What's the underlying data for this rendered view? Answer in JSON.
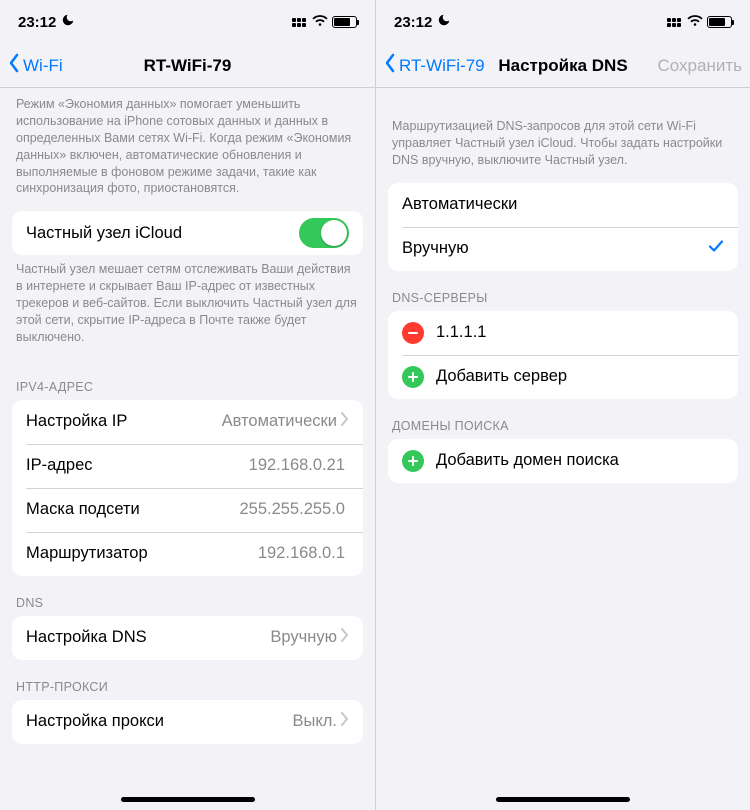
{
  "status": {
    "time": "23:12"
  },
  "left": {
    "nav": {
      "back": "Wi-Fi",
      "title": "RT-WiFi-79"
    },
    "dataSaverFooter": "Режим «Экономия данных» помогает уменьшить использование на iPhone сотовых данных и данных в определенных Вами сетях Wi-Fi. Когда режим «Экономия данных» включен, автоматические обновления и выполняемые в фоновом режиме задачи, такие как синхронизация фото, приостановятся.",
    "privateRelay": {
      "label": "Частный узел iCloud"
    },
    "privateRelayFooter": "Частный узел мешает сетям отслеживать Ваши действия в интернете и скрывает Ваш IP-адрес от известных трекеров и веб-сайтов. Если выключить Частный узел для этой сети, скрытие IP-адреса в Почте также будет выключено.",
    "ipv4": {
      "header": "IPV4-АДРЕС",
      "configure": {
        "label": "Настройка IP",
        "value": "Автоматически"
      },
      "ip": {
        "label": "IP-адрес",
        "value": "192.168.0.21"
      },
      "mask": {
        "label": "Маска подсети",
        "value": "255.255.255.0"
      },
      "router": {
        "label": "Маршрутизатор",
        "value": "192.168.0.1"
      }
    },
    "dns": {
      "header": "DNS",
      "configure": {
        "label": "Настройка DNS",
        "value": "Вручную"
      }
    },
    "proxy": {
      "header": "HTTP-ПРОКСИ",
      "configure": {
        "label": "Настройка прокси",
        "value": "Выкл."
      }
    }
  },
  "right": {
    "nav": {
      "back": "RT-WiFi-79",
      "title": "Настройка DNS",
      "action": "Сохранить"
    },
    "intro": "Маршрутизацией DNS-запросов для этой сети Wi-Fi управляет Частный узел iCloud. Чтобы задать настройки DNS вручную, выключите Частный узел.",
    "mode": {
      "auto": "Автоматически",
      "manual": "Вручную"
    },
    "servers": {
      "header": "DNS-СЕРВЕРЫ",
      "entry": "1.1.1.1",
      "add": "Добавить сервер"
    },
    "domains": {
      "header": "ДОМЕНЫ ПОИСКА",
      "add": "Добавить домен поиска"
    }
  }
}
